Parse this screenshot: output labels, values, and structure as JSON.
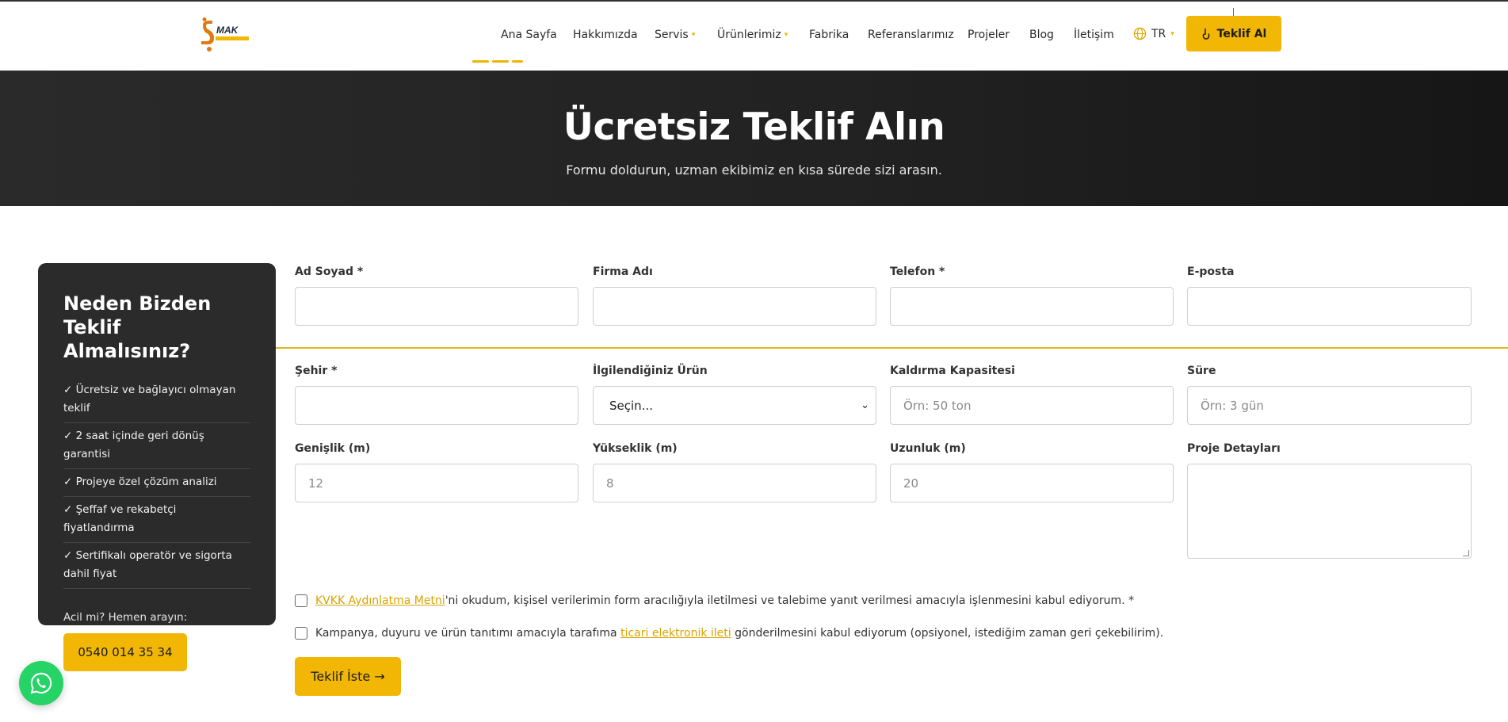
{
  "header": {
    "nav": [
      {
        "label": "Ana Sayfa",
        "caret": false
      },
      {
        "label": "Hakkımızda",
        "caret": false
      },
      {
        "label": "Servis",
        "caret": true
      },
      {
        "label": "Ürünlerimiz",
        "caret": true
      },
      {
        "label": "Fabrika",
        "caret": false
      },
      {
        "label": "Referanslarımız",
        "caret": false
      },
      {
        "label": "Projeler",
        "caret": false
      },
      {
        "label": "Blog",
        "caret": false
      },
      {
        "label": "İletişim",
        "caret": false
      }
    ],
    "lang": "TR",
    "cta_label": "Teklif Al",
    "accent": "#f2b705"
  },
  "hero": {
    "title": "Ücretsiz Teklif Alın",
    "subtitle": "Formu doldurun, uzman ekibimiz en kısa sürede sizi arasın."
  },
  "sidebar": {
    "title": "Neden Bizden Teklif Almalısınız?",
    "benefits": [
      "✓ Ücretsiz ve bağlayıcı olmayan teklif",
      "✓ 2 saat içinde geri dönüş garantisi",
      "✓ Projeye özel çözüm analizi",
      "✓ Şeffaf ve rekabetçi fiyatlandırma",
      "✓ Sertifikalı operatör ve sigorta dahil fiyat"
    ],
    "urgent_text": "Acil mi? Hemen arayın:",
    "phone": "0540 014 35 34"
  },
  "form": {
    "name_label": "Ad Soyad *",
    "company_label": "Firma Adı",
    "phone_label": "Telefon *",
    "email_label": "E-posta",
    "city_label": "Şehir *",
    "product_label": "İlgilendiğiniz Ürün",
    "product_value": "Seçin...",
    "capacity_label": "Kaldırma Kapasitesi",
    "capacity_placeholder": "Örn: 50 ton",
    "duration_label": "Süre",
    "duration_placeholder": "Örn: 3 gün",
    "width_label": "Genişlik (m)",
    "width_placeholder": "12",
    "height_label": "Yükseklik (m)",
    "height_placeholder": "8",
    "length_label": "Uzunluk (m)",
    "length_placeholder": "20",
    "details_label": "Proje Detayları",
    "kvkk_link": "KVKK Aydınlatma Metni",
    "kvkk_text": "'ni okudum, kişisel verilerimin form aracılığıyla iletilmesi ve talebime yanıt verilmesi amacıyla işlenmesini kabul ediyorum. *",
    "marketing_pre": "Kampanya, duyuru ve ürün tanıtımı amacıyla tarafıma",
    "marketing_link": "ticari elektronik ileti",
    "marketing_post": "gönderilmesini kabul ediyorum (opsiyonel, istediğim zaman geri çekebilirim).",
    "submit_label": "Teklif İste →"
  }
}
